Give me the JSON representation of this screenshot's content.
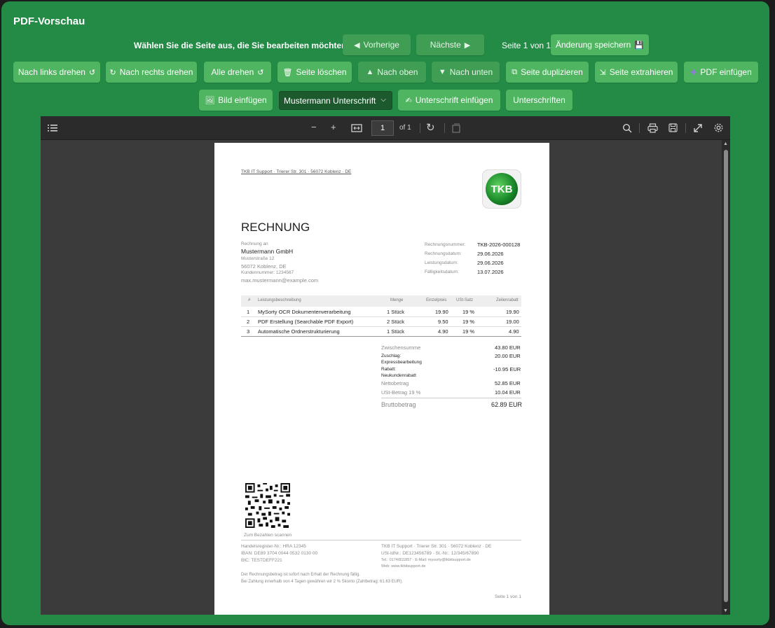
{
  "panel": {
    "title": "PDF-Vorschau",
    "page_prompt": "Wählen Sie die Seite aus, die Sie bearbeiten möchten:",
    "prev_label": "Vorherige",
    "next_label": "Nächste",
    "page_status": "Seite 1 von 1",
    "save_label": "Änderung speichern",
    "rotate_left": "Nach links drehen",
    "rotate_right": "Nach rechts drehen",
    "rotate_all": "Alle drehen",
    "delete_page": "Seite löschen",
    "move_up": "Nach oben",
    "move_down": "Nach unten",
    "duplicate": "Seite duplizieren",
    "extract": "Seite extrahieren",
    "insert_pdf": "PDF einfügen",
    "insert_image": "Bild einfügen",
    "signature_select": "Mustermann Unterschrift",
    "insert_signature": "Unterschrift einfügen",
    "signatures": "Unterschriften"
  },
  "viewer": {
    "page_number": "1",
    "page_total": "of 1"
  },
  "invoice": {
    "sender_line": "TKB IT Support · Trierer Str. 301 · 56072 Koblenz · DE",
    "logo_text": "TKB",
    "heading": "RECHNUNG",
    "recipient_label": "Rechnung an",
    "recipient_name": "Mustermann GmbH",
    "recipient_street": "Musterstraße 12",
    "recipient_city": "56072 Koblenz, DE",
    "customer_no": "Kundennummer: 1234567",
    "recipient_email": "max.mustermann@example.com",
    "meta": [
      {
        "label": "Rechnungsnummer:",
        "value": "TKB-2026-000128"
      },
      {
        "label": "Rechnungsdatum:",
        "value": "29.06.2026"
      },
      {
        "label": "Leistungsdatum:",
        "value": "29.06.2026"
      },
      {
        "label": "Fälligkeitsdatum:",
        "value": "13.07.2026"
      }
    ],
    "table_headers": [
      "#",
      "Leistungsbeschreibung",
      "Menge",
      "Einzelpreis",
      "USt-Satz",
      "Zeilenrabatt"
    ],
    "rows": [
      {
        "n": "1",
        "desc": "MySorty OCR Dokumentenverarbeitung",
        "qty": "1 Stück",
        "price": "19.90",
        "vat": "19 %",
        "total": "19.90"
      },
      {
        "n": "2",
        "desc": "PDF Erstellung (Searchable PDF Export)",
        "qty": "2 Stück",
        "price": "9.50",
        "vat": "19 %",
        "total": "19.00"
      },
      {
        "n": "3",
        "desc": "Automatische Ordnerstrukturierung",
        "qty": "1 Stück",
        "price": "4.90",
        "vat": "19 %",
        "total": "4.90"
      }
    ],
    "subtotal_label": "Zwischensumme",
    "subtotal_value": "43.80 EUR",
    "surcharge_label": "Zuschlag:",
    "surcharge_desc": "Expressbearbeitung",
    "surcharge_value": "20.00 EUR",
    "discount_label": "Rabatt:",
    "discount_desc": "Neukundenrabatt",
    "discount_value": "-10.95 EUR",
    "net_label": "Nettobetrag",
    "net_value": "52.85 EUR",
    "vat_label": "USt-Betrag 19 %",
    "vat_value": "10.04 EUR",
    "gross_label": "Bruttobetrag",
    "gross_value": "62.89 EUR",
    "qr_caption": "Zum Bezahlen scannen",
    "footer_left": [
      "Handelsregister-Nr.: HRA 12345",
      "IBAN: DE89 3704 0044 0532 0130 00",
      "BIC: TESTDEFF221"
    ],
    "footer_right": [
      "TKB IT Support · Trierer Str. 301 · 56072 Koblenz · DE",
      "USt-IdNr.: DE123456789 · St.-Nr.: 12/345/67890",
      "Tel.: 0174/811857 · E-Mail: mysorty@tkbitsupport.de",
      "Web: www.tkbitsupport.de"
    ],
    "note1": "Der Rechnungsbetrag ist sofort nach Erhalt der Rechnung fällig.",
    "note2": "Bei Zahlung innerhalb von 4 Tagen gewähren wir 2 % Skonto (Zahlbetrag: 61.63 EUR).",
    "page_footer": "Seite 1 von 1"
  },
  "icons": {
    "prev": "◀",
    "next": "▶",
    "save": "💾",
    "rot_l": "↺",
    "rot_r": "↻",
    "trash": "🗑",
    "up": "▲",
    "down": "▼",
    "dup": "⧉",
    "extract": "⇲",
    "plus": "✚",
    "image": "🖼",
    "sign": "✍"
  },
  "colors": {
    "panel": "#238b45",
    "button": "#4fb560",
    "select": "#1c5a2e"
  }
}
